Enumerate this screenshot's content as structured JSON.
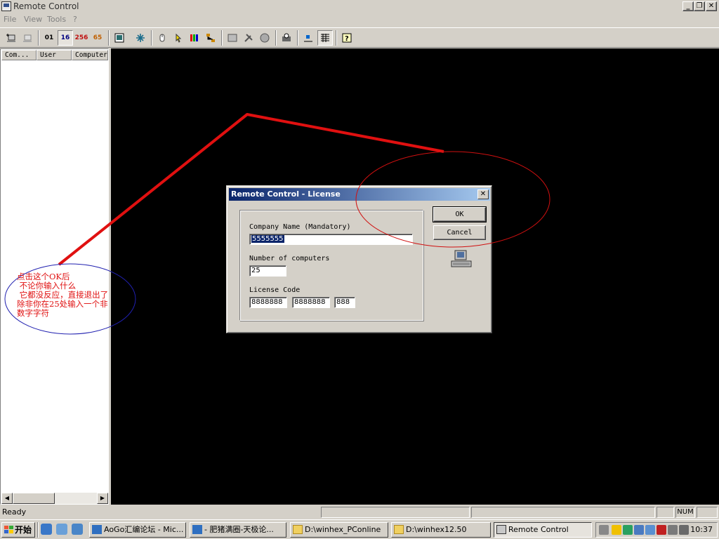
{
  "window": {
    "title": "Remote Control"
  },
  "menu": [
    "File",
    "View",
    "Tools",
    "?"
  ],
  "toolbar": {
    "color_labels": [
      "01",
      "16",
      "256",
      "65"
    ]
  },
  "list": {
    "columns": [
      "Com...",
      "User",
      "Computer"
    ]
  },
  "status": {
    "text": "Ready",
    "num": "NUM"
  },
  "annotation": {
    "text": "点击这个OK后\n 不论你输入什么\n 它都没反应，直接退出了\n除非你在25处输入一个非\n数字字符"
  },
  "dialog": {
    "title": "Remote Control - License",
    "close": "✕",
    "company_label": "Company Name (Mandatory)",
    "company_value": "5555555",
    "computers_label": "Number of computers",
    "computers_value": "25",
    "license_label": "License Code",
    "license_parts": [
      "8888888",
      "8888888",
      "888"
    ],
    "ok": "OK",
    "cancel": "Cancel"
  },
  "taskbar": {
    "start": "开始",
    "tasks": [
      "AoGo汇编论坛 - Mic...",
      "- 肥猪满圈-天极论...",
      "D:\\winhex_PConline",
      "D:\\winhex12.50",
      "Remote Control"
    ],
    "clock": "10:37"
  },
  "colors": {
    "annotation_red": "#e01010",
    "title_gradient_start": "#0a246a",
    "title_gradient_end": "#a6caf0"
  }
}
